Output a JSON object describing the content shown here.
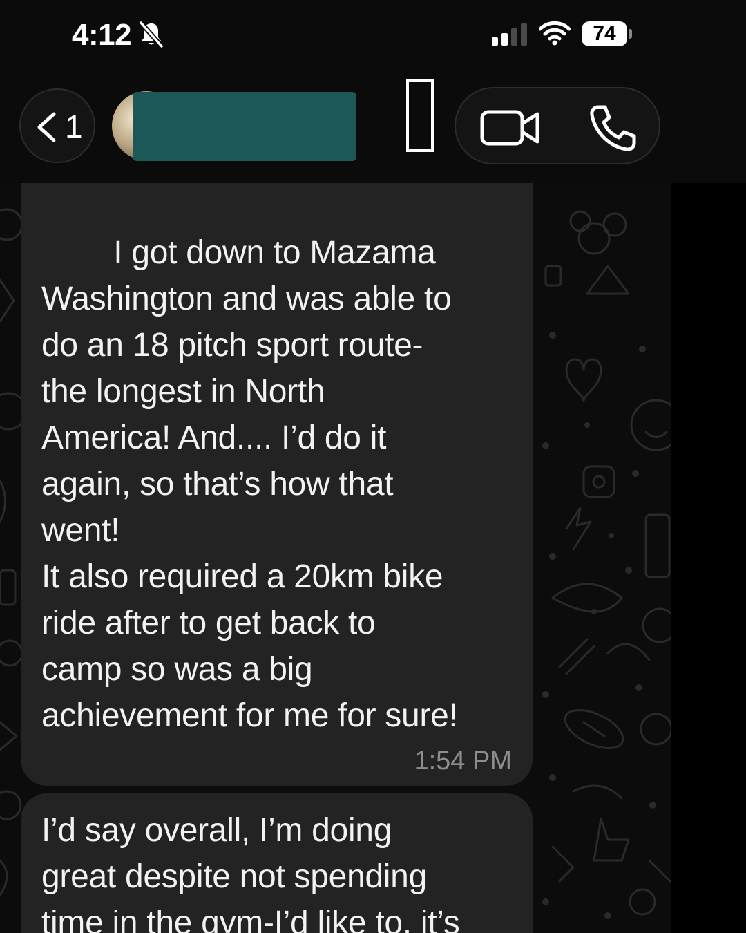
{
  "status_bar": {
    "time": "4:12",
    "battery": "74",
    "icons": [
      "bell-slash-icon",
      "signal-icon",
      "wifi-icon",
      "battery-icon"
    ]
  },
  "header": {
    "back_count": "1",
    "icons": [
      "chevron-left-icon",
      "avatar",
      "video-call-icon",
      "phone-call-icon"
    ]
  },
  "messages": [
    {
      "text": "        I got down to Mazama\nWashington and was able to\ndo an 18 pitch sport route-\nthe longest in North\nAmerica! And.... I’d do it\nagain, so that’s how that\nwent!\nIt also required a 20km bike\nride after to get back to\ncamp so was a big\nachievement for me for sure!",
      "time": "1:54 PM"
    },
    {
      "text": "I’d say overall, I’m doing\ngreat despite not spending\ntime in the gym-I’d like to, it’s"
    }
  ],
  "colors": {
    "bubble": "#232323",
    "chat_background": "#0c0c0c",
    "redaction": "#1b5857",
    "timestamp": "#8d8d8d"
  }
}
